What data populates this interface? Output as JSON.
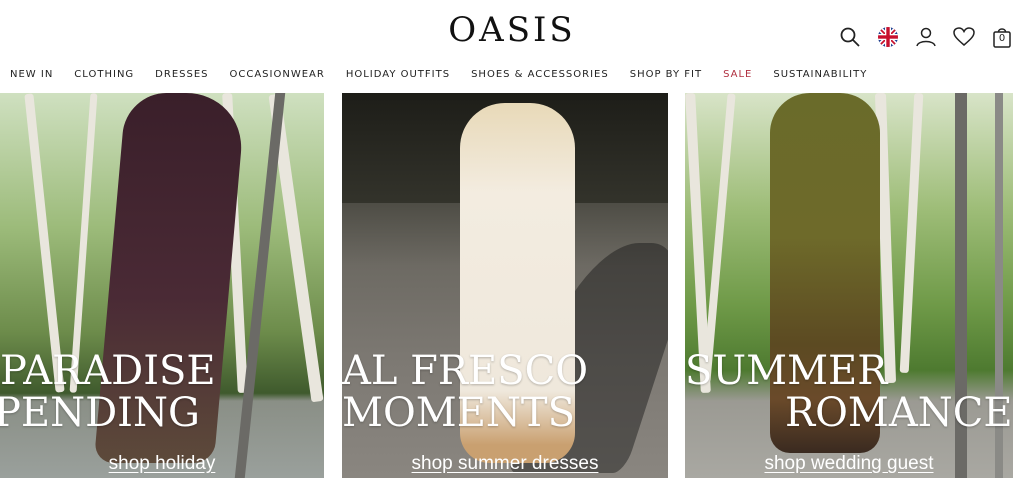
{
  "brand": {
    "logo": "OASIS"
  },
  "header_icons": [
    "search-icon",
    "uk-flag-icon",
    "account-icon",
    "wishlist-heart-icon",
    "bag-icon"
  ],
  "bag_count": "0",
  "nav": {
    "items": [
      {
        "label": "NEW IN"
      },
      {
        "label": "CLOTHING"
      },
      {
        "label": "DRESSES"
      },
      {
        "label": "OCCASIONWEAR"
      },
      {
        "label": "HOLIDAY OUTFITS"
      },
      {
        "label": "SHOES & ACCESSORIES"
      },
      {
        "label": "SHOP BY FIT"
      },
      {
        "label": "SALE"
      },
      {
        "label": "SUSTAINABILITY"
      }
    ]
  },
  "colors": {
    "sale": "#b03040",
    "headline": "#ffffff"
  },
  "panels": [
    {
      "line1": "PARADISE",
      "line2": "PENDING",
      "cta": "shop holiday"
    },
    {
      "line1": "AL FRESCO",
      "line2": "MOMENTS",
      "cta": "shop summer dresses"
    },
    {
      "line1": "SUMMER",
      "line2": "ROMANCE",
      "cta": "shop wedding guest"
    }
  ]
}
